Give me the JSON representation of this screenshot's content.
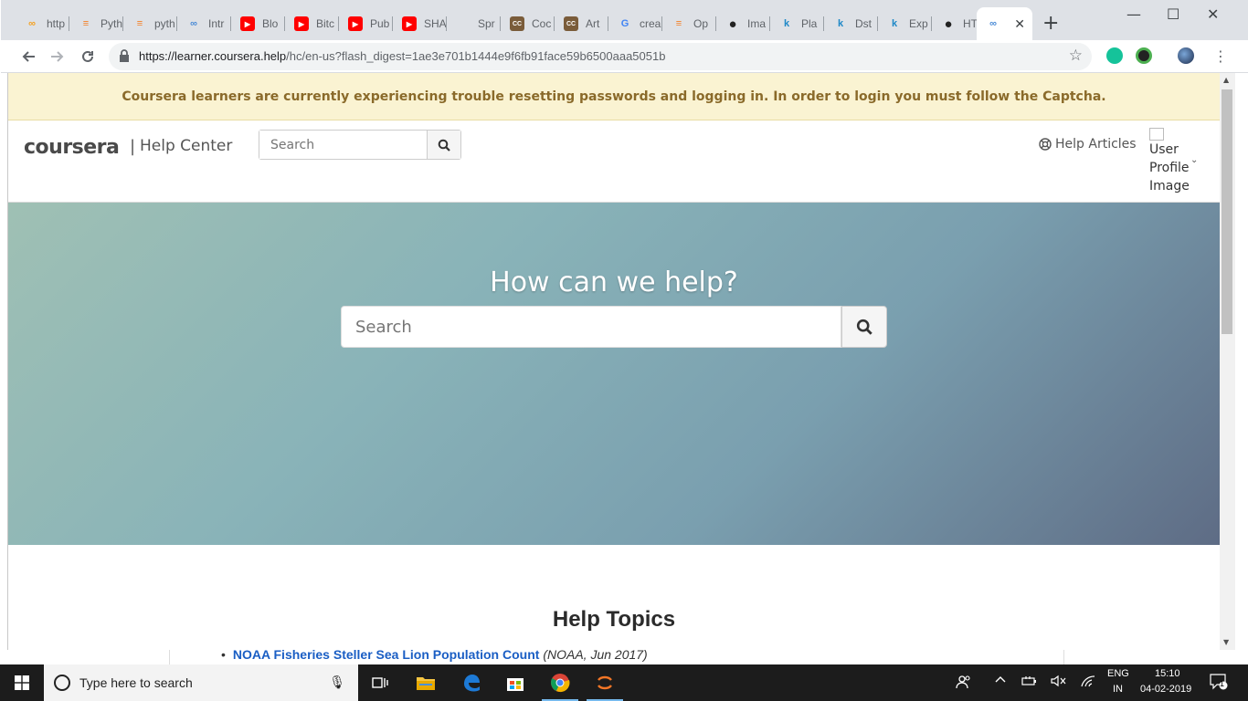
{
  "browser": {
    "tabs": [
      {
        "label": "http",
        "icon": "co-icon",
        "color": "#f4a020"
      },
      {
        "label": "Pyth",
        "icon": "stackoverflow-icon",
        "color": "#f48024"
      },
      {
        "label": "pyth",
        "icon": "stackoverflow-icon",
        "color": "#f48024"
      },
      {
        "label": "Intr",
        "icon": "co-icon",
        "color": "#4a8bd6"
      },
      {
        "label": "Blo",
        "icon": "youtube-icon",
        "color": "#ff0000"
      },
      {
        "label": "Bitc",
        "icon": "youtube-icon",
        "color": "#ff0000"
      },
      {
        "label": "Pub",
        "icon": "youtube-icon",
        "color": "#ff0000"
      },
      {
        "label": "SHA",
        "icon": "youtube-icon",
        "color": "#ff0000"
      },
      {
        "label": "Spr",
        "icon": "apple-icon",
        "color": "#555555"
      },
      {
        "label": "Coc",
        "icon": "cc-icon",
        "color": "#7a5c3a"
      },
      {
        "label": "Art",
        "icon": "cc-icon",
        "color": "#7a5c3a"
      },
      {
        "label": "crea",
        "icon": "google-icon",
        "color": "#4285f4"
      },
      {
        "label": "Op",
        "icon": "stackoverflow-icon",
        "color": "#f48024"
      },
      {
        "label": "Ima",
        "icon": "circle-icon",
        "color": "#222222"
      },
      {
        "label": "Pla",
        "icon": "k-icon",
        "color": "#1e88c7"
      },
      {
        "label": "Dst",
        "icon": "k-icon",
        "color": "#1e88c7"
      },
      {
        "label": "Exp",
        "icon": "k-icon",
        "color": "#1e88c7"
      },
      {
        "label": "HT",
        "icon": "github-icon",
        "color": "#222222"
      },
      {
        "label": "",
        "icon": "co-icon",
        "color": "#4a8bd6"
      }
    ],
    "url_host": "https://learner.coursera.help",
    "url_rest": "/hc/en-us?flash_digest=1ae3e701b1444e9f6fb91face59b6500aaa5051b"
  },
  "page": {
    "notice": "Coursera learners are currently experiencing trouble resetting passwords and logging in. In order to login you must follow the Captcha.",
    "logo": "coursera",
    "logo_sep": "|",
    "logo_sub": "Help Center",
    "header_search_placeholder": "Search",
    "help_articles": "Help Articles",
    "profile_alt": "User Profile Image",
    "hero_title": "How can we help?",
    "hero_search_placeholder": "Search",
    "topics_title": "Help Topics"
  },
  "behind": {
    "bullet": "•",
    "link": "NOAA Fisheries Steller Sea Lion Population Count",
    "source": "(NOAA, Jun 2017)"
  },
  "taskbar": {
    "search_placeholder": "Type here to search",
    "lang_top": "ENG",
    "lang_bottom": "IN",
    "time": "15:10",
    "date": "04-02-2019",
    "notif_count": "1"
  },
  "colors": {
    "notice_bg": "#faf3d2",
    "notice_text": "#8a6a2a",
    "hero_start": "#9fc0b4",
    "hero_end": "#5e6c85",
    "link": "#1a5ec4"
  }
}
